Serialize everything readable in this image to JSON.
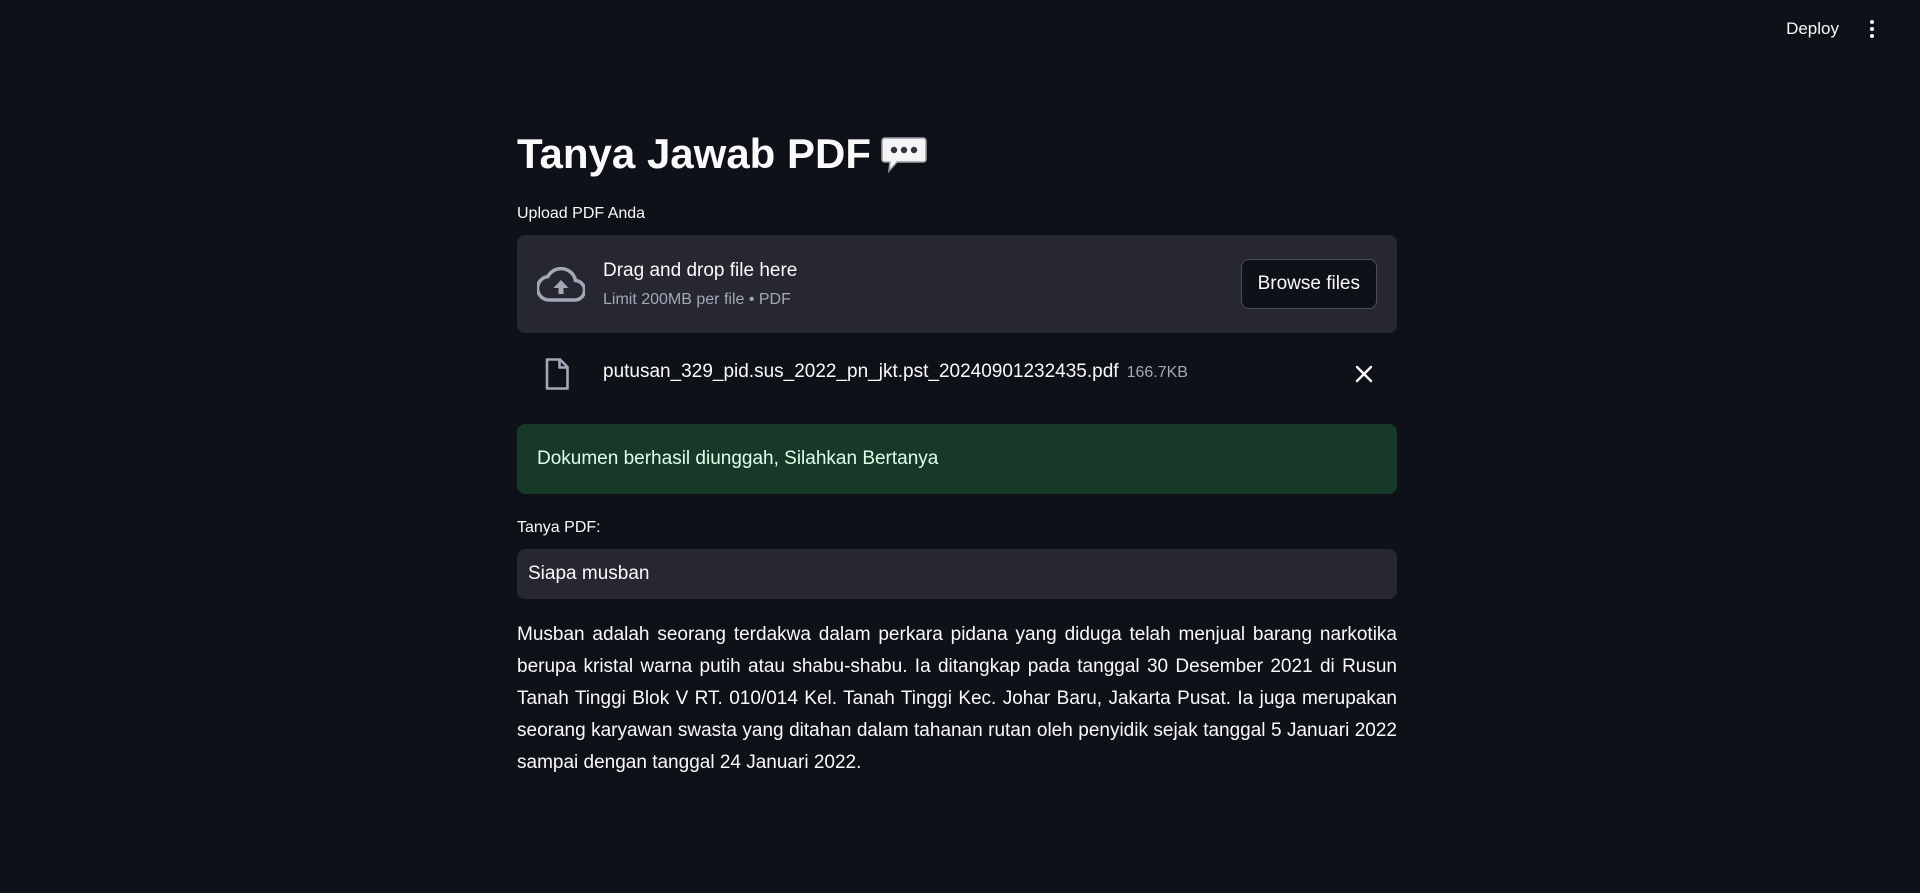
{
  "header": {
    "deploy_label": "Deploy",
    "menu_icon": "more-vertical-icon"
  },
  "main": {
    "title": "Tanya Jawab PDF",
    "title_icon": "speech-balloon-icon"
  },
  "uploader": {
    "label": "Upload PDF Anda",
    "drag_text": "Drag and drop file here",
    "limit_text": "Limit 200MB per file • PDF",
    "browse_label": "Browse files",
    "icon": "cloud-upload-icon"
  },
  "uploaded_file": {
    "name": "putusan_329_pid.sus_2022_pn_jkt.pst_20240901232435.pdf",
    "size": "166.7KB",
    "icon": "file-icon",
    "remove_icon": "close-icon"
  },
  "status": {
    "message": "Dokumen berhasil diunggah, Silahkan Bertanya",
    "color": "#173928"
  },
  "question": {
    "label": "Tanya PDF:",
    "value": "Siapa musban"
  },
  "answer": {
    "text": "Musban adalah seorang terdakwa dalam perkara pidana yang diduga telah menjual barang narkotika berupa kristal warna putih atau shabu-shabu. Ia ditangkap pada tanggal 30 Desember 2021 di Rusun Tanah Tinggi Blok V RT. 010/014 Kel. Tanah Tinggi Kec. Johar Baru, Jakarta Pusat. Ia juga merupakan seorang karyawan swasta yang ditahan dalam tahanan rutan oleh penyidik sejak tanggal 5 Januari 2022 sampai dengan tanggal 24 Januari 2022."
  },
  "colors": {
    "background": "#0e1117",
    "surface": "#262730",
    "success_text": "#dffde9"
  }
}
